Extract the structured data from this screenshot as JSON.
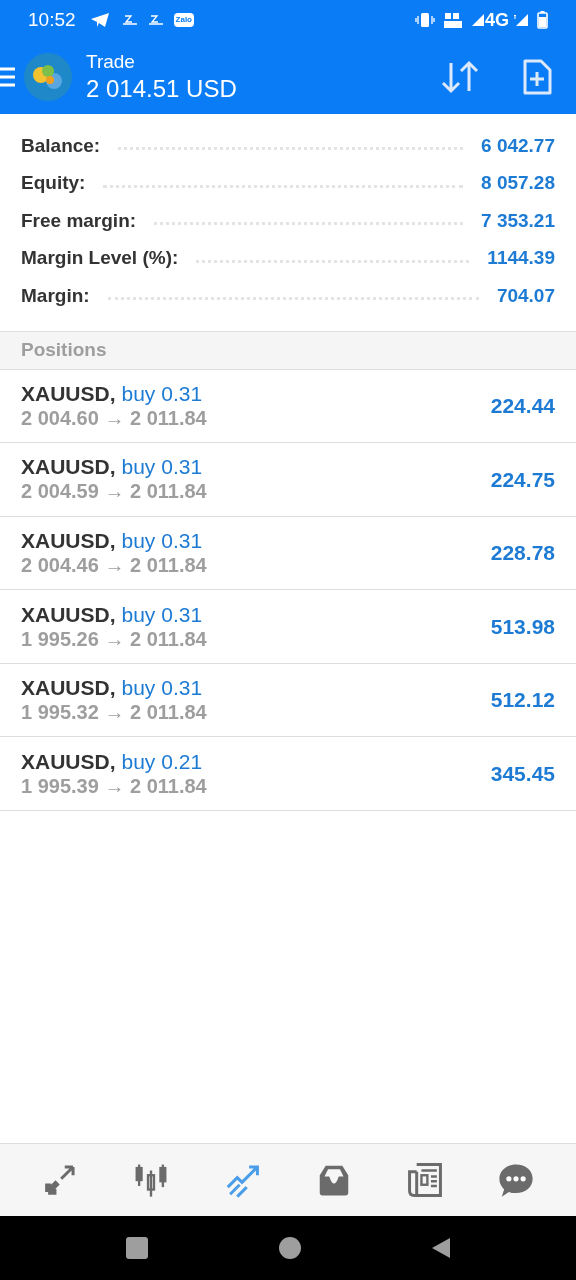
{
  "status_bar": {
    "time": "10:52",
    "zalo": "Zalo",
    "network": "4G"
  },
  "header": {
    "title": "Trade",
    "subtitle": "2 014.51 USD"
  },
  "summary": [
    {
      "label": "Balance:",
      "value": "6 042.77"
    },
    {
      "label": "Equity:",
      "value": "8 057.28"
    },
    {
      "label": "Free margin:",
      "value": "7 353.21"
    },
    {
      "label": "Margin Level (%):",
      "value": "1144.39"
    },
    {
      "label": "Margin:",
      "value": "704.07"
    }
  ],
  "positions_heading": "Positions",
  "positions": [
    {
      "symbol": "XAUUSD,",
      "side": "buy 0.31",
      "prices": "2 004.60 → 2 011.84",
      "profit": "224.44"
    },
    {
      "symbol": "XAUUSD,",
      "side": "buy 0.31",
      "prices": "2 004.59 → 2 011.84",
      "profit": "224.75"
    },
    {
      "symbol": "XAUUSD,",
      "side": "buy 0.31",
      "prices": "2 004.46 → 2 011.84",
      "profit": "228.78"
    },
    {
      "symbol": "XAUUSD,",
      "side": "buy 0.31",
      "prices": "1 995.26 → 2 011.84",
      "profit": "513.98"
    },
    {
      "symbol": "XAUUSD,",
      "side": "buy 0.31",
      "prices": "1 995.32 → 2 011.84",
      "profit": "512.12"
    },
    {
      "symbol": "XAUUSD,",
      "side": "buy 0.21",
      "prices": "1 995.39 → 2 011.84",
      "profit": "345.45"
    }
  ],
  "bottom_nav": [
    {
      "kind": "quotes",
      "selected": false
    },
    {
      "kind": "chart",
      "selected": false
    },
    {
      "kind": "trade",
      "selected": true
    },
    {
      "kind": "history",
      "selected": false
    },
    {
      "kind": "news",
      "selected": false
    },
    {
      "kind": "chat",
      "selected": false
    }
  ]
}
